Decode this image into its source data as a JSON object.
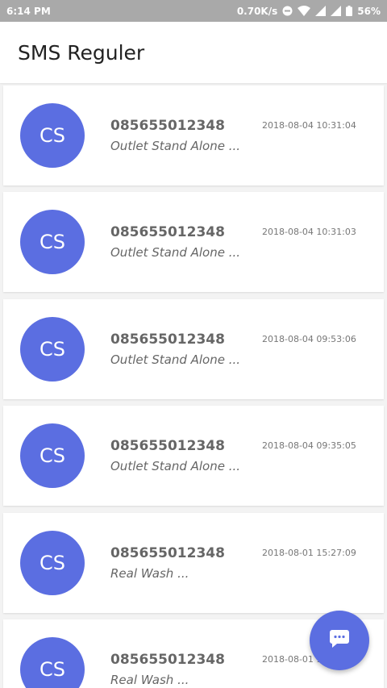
{
  "status_bar": {
    "time": "6:14 PM",
    "net_speed": "0.70K/s",
    "battery": "56%",
    "icons": [
      "dnd-icon",
      "wifi-icon",
      "signal-icon",
      "signal-icon",
      "battery-icon"
    ]
  },
  "app_bar": {
    "title": "SMS Reguler"
  },
  "messages": [
    {
      "avatar": "CS",
      "phone": "085655012348",
      "preview": "Outlet Stand Alone ...",
      "date": "2018-08-04 10:31:04"
    },
    {
      "avatar": "CS",
      "phone": "085655012348",
      "preview": "Outlet Stand Alone ...",
      "date": "2018-08-04 10:31:03"
    },
    {
      "avatar": "CS",
      "phone": "085655012348",
      "preview": "Outlet Stand Alone ...",
      "date": "2018-08-04 09:53:06"
    },
    {
      "avatar": "CS",
      "phone": "085655012348",
      "preview": "Outlet Stand Alone ...",
      "date": "2018-08-04 09:35:05"
    },
    {
      "avatar": "CS",
      "phone": "085655012348",
      "preview": "Real Wash ...",
      "date": "2018-08-01 15:27:09"
    },
    {
      "avatar": "CS",
      "phone": "085655012348",
      "preview": "Real Wash ...",
      "date": "2018-08-01 1..."
    }
  ],
  "fab": {
    "icon": "message-icon"
  },
  "colors": {
    "accent": "#5b6ee1",
    "status_bar": "#a9a9a9"
  }
}
